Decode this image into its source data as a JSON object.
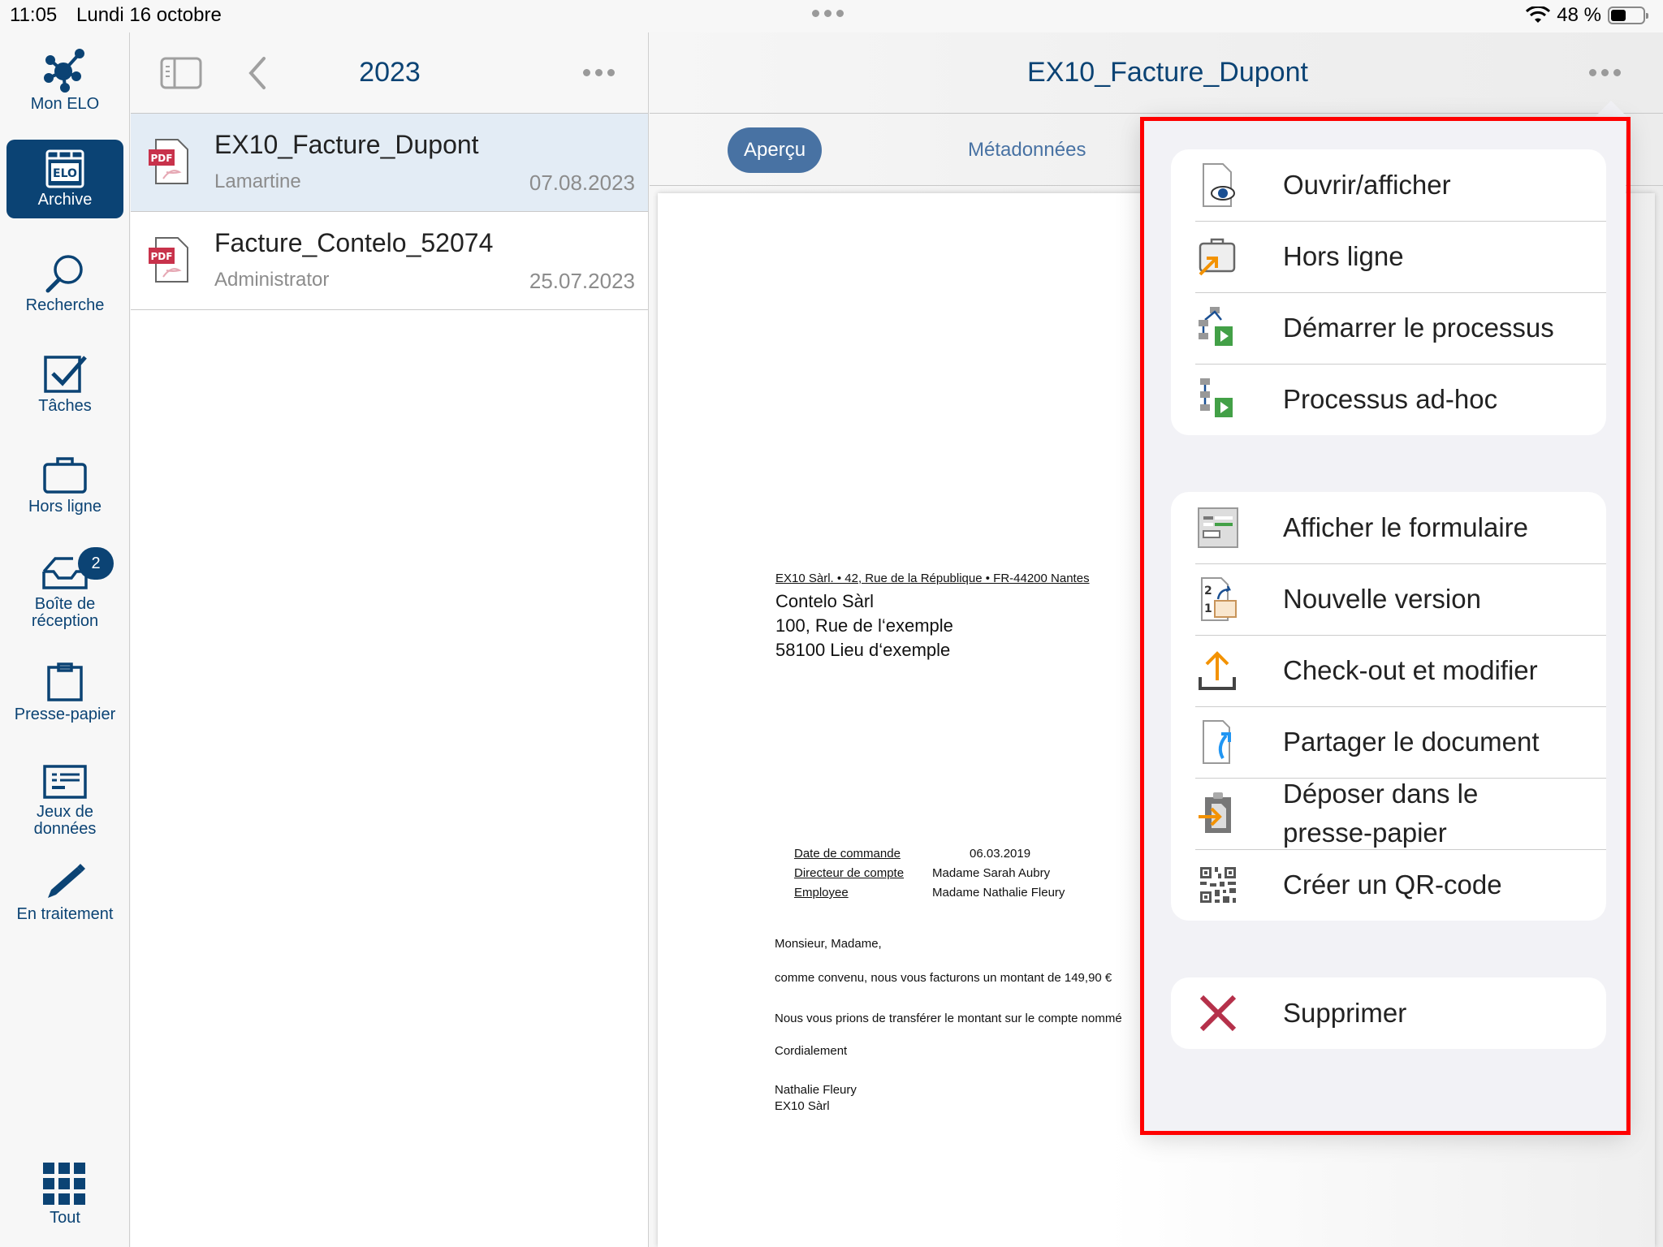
{
  "status_bar": {
    "time": "11:05",
    "date": "Lundi 16 octobre",
    "battery_text": "48 %",
    "battery_level": 0.48
  },
  "nav": {
    "items": [
      {
        "id": "mon-elo",
        "label": "Mon ELO",
        "icon": "network-hub-icon"
      },
      {
        "id": "archive",
        "label": "Archive",
        "icon": "elo-archive-icon",
        "active": true
      },
      {
        "id": "recherche",
        "label": "Recherche",
        "icon": "search-icon"
      },
      {
        "id": "taches",
        "label": "Tâches",
        "icon": "checkbox-icon"
      },
      {
        "id": "hors-ligne",
        "label": "Hors ligne",
        "icon": "briefcase-icon"
      },
      {
        "id": "boite",
        "label": "Boîte de réception",
        "label_line1": "Boîte de",
        "label_line2": "réception",
        "icon": "inbox-tray-icon",
        "badge": "2"
      },
      {
        "id": "presse-papier",
        "label": "Presse-papier",
        "icon": "clipboard-icon"
      },
      {
        "id": "jeux",
        "label": "Jeux de données",
        "label_line1": "Jeux de",
        "label_line2": "données",
        "icon": "dataset-form-icon"
      },
      {
        "id": "en-traitement",
        "label": "En traitement",
        "icon": "pen-icon"
      },
      {
        "id": "tout",
        "label": "Tout",
        "icon": "grid-icon"
      }
    ],
    "accent": "#0b4374"
  },
  "list": {
    "title": "2023",
    "items": [
      {
        "name": "EX10_Facture_Dupont",
        "author": "Lamartine",
        "date": "07.08.2023",
        "type": "PDF",
        "selected": true
      },
      {
        "name": "Facture_Contelo_52074",
        "author": "Administrator",
        "date": "25.07.2023",
        "type": "PDF",
        "selected": false
      }
    ]
  },
  "detail": {
    "title": "EX10_Facture_Dupont",
    "tabs": [
      {
        "label": "Aperçu",
        "active": true
      },
      {
        "label": "Métadonnées",
        "active": false
      }
    ],
    "document": {
      "sender_line": "EX10 Sàrl. • 42, Rue de la République • FR-44200 Nantes",
      "recipient": [
        "Contelo Sàrl",
        "100, Rue de l‘exemple",
        "58100 Lieu d‘exemple"
      ],
      "order_rows": [
        {
          "label": "Date de commande",
          "value": "06.03.2019"
        },
        {
          "label": "Directeur de compte",
          "value": "Madame Sarah Aubry"
        },
        {
          "label": "Employee",
          "value": "Madame Nathalie Fleury"
        }
      ],
      "salutation": "Monsieur, Madame,",
      "para1": "comme convenu, nous vous facturons un montant de 149,90 €",
      "para2": "Nous vous prions de transférer le montant sur le compte nommé",
      "closing": "Cordialement",
      "signature_name": "Nathalie Fleury",
      "signature_company": "EX10 Sàrl"
    }
  },
  "action_menu": {
    "groups": [
      [
        {
          "label": "Ouvrir/afficher",
          "icon": "document-eye-icon"
        },
        {
          "label": "Hors ligne",
          "icon": "offline-briefcase-icon"
        },
        {
          "label": "Démarrer le processus",
          "icon": "start-workflow-icon"
        },
        {
          "label": "Processus ad-hoc",
          "icon": "adhoc-workflow-icon"
        }
      ],
      [
        {
          "label": "Afficher le formulaire",
          "icon": "form-icon"
        },
        {
          "label": "Nouvelle version",
          "icon": "new-version-icon"
        },
        {
          "label": "Check-out et modifier",
          "icon": "checkout-upload-icon"
        },
        {
          "label": "Partager le document",
          "icon": "share-document-icon"
        },
        {
          "label": "Déposer dans le presse-papier",
          "label_line1": "Déposer dans le",
          "label_line2": "presse-papier",
          "icon": "clipboard-drop-icon"
        },
        {
          "label": "Créer un QR-code",
          "icon": "qr-code-icon"
        }
      ],
      [
        {
          "label": "Supprimer",
          "icon": "delete-x-icon",
          "color": "#b5304a"
        }
      ]
    ],
    "highlight_color": "#ff0000"
  }
}
